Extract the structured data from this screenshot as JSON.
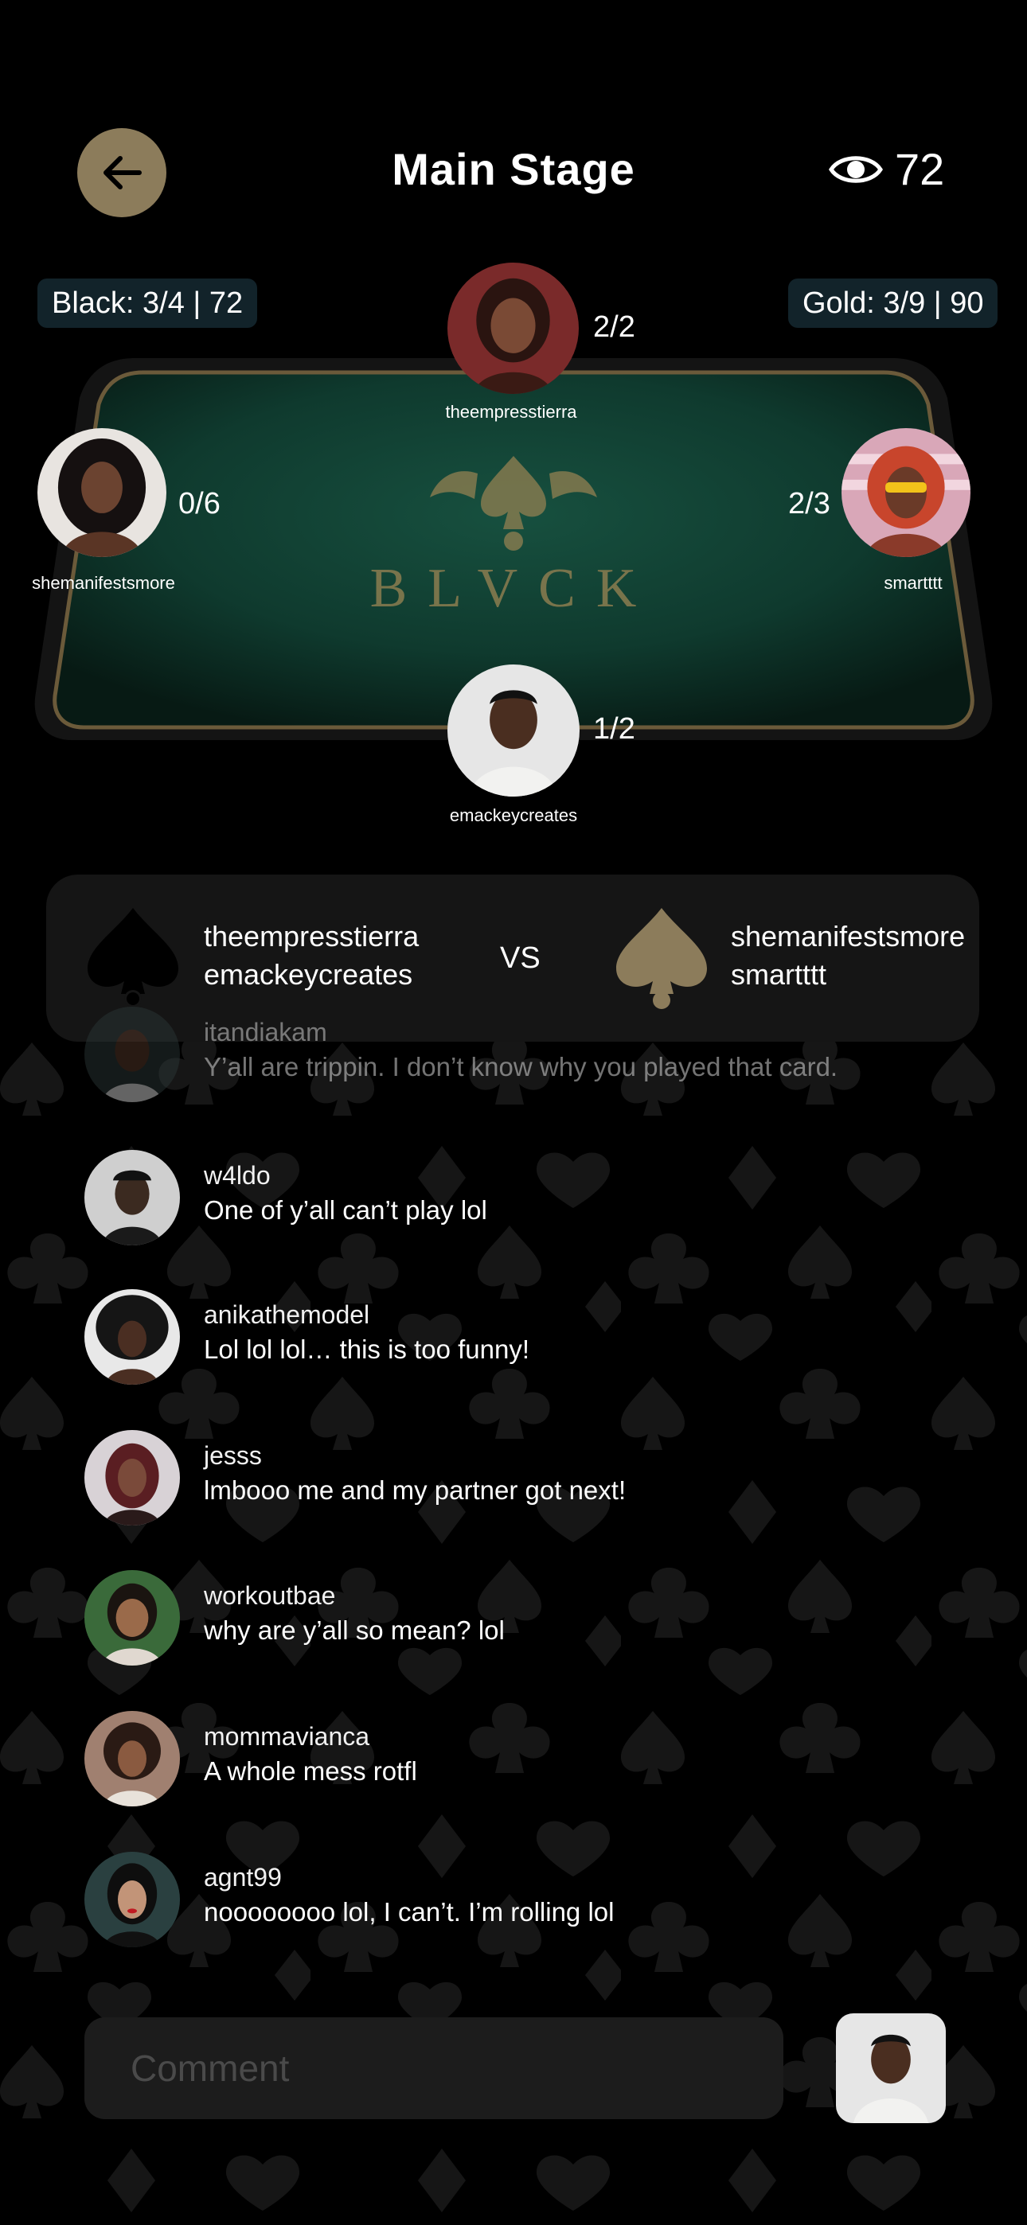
{
  "header": {
    "back_icon": "arrow-left-icon",
    "title": "Main Stage",
    "viewers_icon": "eye-icon",
    "viewer_count": "72"
  },
  "scores": {
    "black": "Black: 3/4 | 72",
    "gold": "Gold: 3/9 | 90"
  },
  "table": {
    "brand": "BLVCK",
    "felt_color": "#0f3a2e",
    "rim_color": "#6b5a3a"
  },
  "players": {
    "top": {
      "name": "theempresstierra",
      "score": "2/2"
    },
    "left": {
      "name": "shemanifestsmore",
      "score": "0/6"
    },
    "right": {
      "name": "smartttt",
      "score": "2/3"
    },
    "bottom": {
      "name": "emackeycreates",
      "score": "1/2"
    }
  },
  "match": {
    "black_team": {
      "icon": "spade-black-icon",
      "member_1": "theempresstierra",
      "member_2": "emackeycreates"
    },
    "vs": "VS",
    "gold_team": {
      "icon": "spade-gold-icon",
      "member_1": "shemanifestsmore",
      "member_2": "smartttt"
    }
  },
  "chat": [
    {
      "user": "itandiakam",
      "message": "Y’all are trippin. I don’t know why you played that card."
    },
    {
      "user": "w4ldo",
      "message": "One of y’all can’t play lol"
    },
    {
      "user": "anikathemodel",
      "message": "Lol lol lol… this is too funny!"
    },
    {
      "user": "jesss",
      "message": "lmbooo me and my partner got next!"
    },
    {
      "user": "workoutbae",
      "message": "why are y’all so mean? lol"
    },
    {
      "user": "mommavianca",
      "message": "A whole mess rotfl"
    },
    {
      "user": "agnt99",
      "message": "noooooooo lol, I can’t. I’m rolling lol"
    }
  ],
  "comment": {
    "placeholder": "Comment"
  },
  "colors": {
    "gold": "#8c7c5b",
    "badge_bg": "#12232a",
    "card_bg": "#151515"
  }
}
